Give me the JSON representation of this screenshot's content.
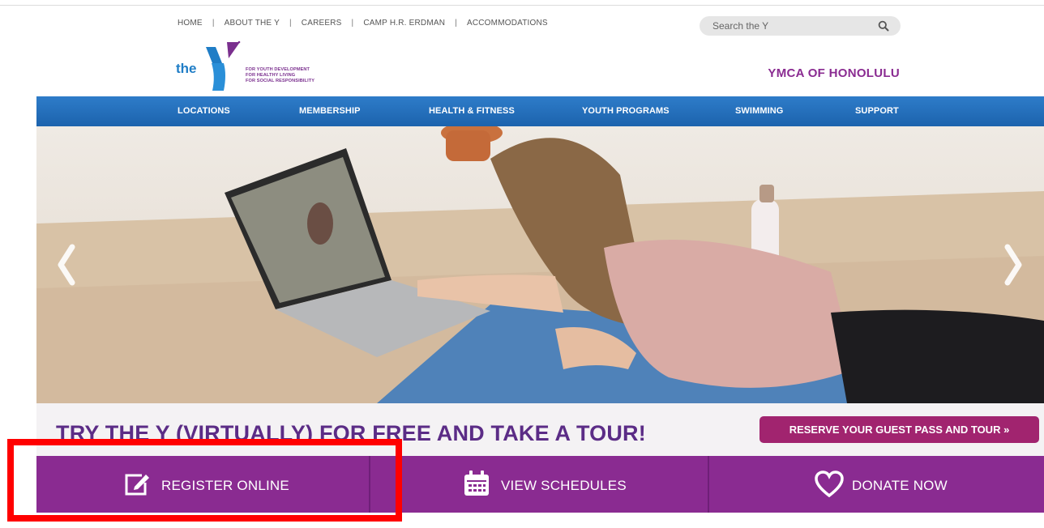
{
  "utility_nav": {
    "items": [
      "HOME",
      "ABOUT THE Y",
      "CAREERS",
      "CAMP H.R. ERDMAN",
      "ACCOMMODATIONS"
    ],
    "separator": "|"
  },
  "search": {
    "placeholder": "Search the Y",
    "icon": "magnifier-icon"
  },
  "logo": {
    "word": "the",
    "tagline": [
      "FOR YOUTH DEVELOPMENT",
      "FOR HEALTHY LIVING",
      "FOR SOCIAL RESPONSIBILITY"
    ]
  },
  "org_name": "YMCA OF HONOLULU",
  "main_nav": {
    "items": [
      "LOCATIONS",
      "MEMBERSHIP",
      "HEALTH & FITNESS",
      "YOUTH PROGRAMS",
      "SWIMMING",
      "SUPPORT"
    ]
  },
  "hero": {
    "headline": "TRY THE Y (VIRTUALLY) FOR FREE AND TAKE A TOUR!",
    "cta": "RESERVE YOUR GUEST PASS AND TOUR »"
  },
  "actions": [
    {
      "label": "REGISTER ONLINE",
      "icon": "edit-icon"
    },
    {
      "label": "VIEW SCHEDULES",
      "icon": "calendar-icon"
    },
    {
      "label": "DONATE NOW",
      "icon": "heart-icon"
    }
  ],
  "colors": {
    "nav_blue": "#1f6ab6",
    "ymca_purple": "#8a2b91",
    "headline_purple": "#5b2c86",
    "cta_magenta": "#a1246f",
    "highlight_red": "#ff0000"
  }
}
